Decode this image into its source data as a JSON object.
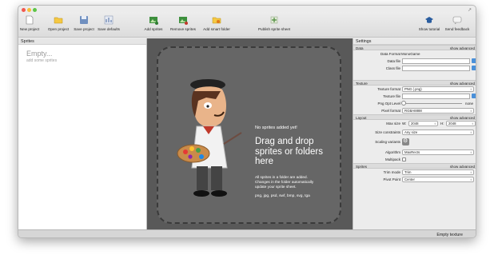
{
  "toolbar": {
    "new_project": "New project",
    "open_project": "Open project",
    "save_project": "Save project",
    "save_defaults": "Save defaults",
    "add_sprites": "Add sprites",
    "remove_sprites": "Remove sprites",
    "add_smart_folder": "Add smart folder",
    "publish": "Publish sprite sheet",
    "show_tutorial": "Show tutorial",
    "send_feedback": "Send feedback"
  },
  "sprites_panel": {
    "header": "Sprites",
    "empty_title": "Empty...",
    "empty_hint": "add some sprites"
  },
  "drop_area": {
    "no_sprites": "No sprites added yet!",
    "headline": "Drag and drop sprites or folders here",
    "info": "All sprites in a folder are added. Changes in the folder automatically update your sprite sheet.",
    "formats": "png, jpg, psd, swf, bmp, svg, tga"
  },
  "settings": {
    "header": "Settings",
    "show_advanced": "show advanced",
    "data": {
      "title": "Data",
      "data_format_label": "Data Format",
      "data_format_value": "MonoGame",
      "data_file_label": "Data file",
      "class_file_label": "Class file"
    },
    "texture": {
      "title": "Texture",
      "texture_format_label": "Texture format",
      "texture_format_value": "PNG (.png)",
      "texture_file_label": "Texture file",
      "png_opt_label": "Png Opt Level",
      "png_opt_value": "none",
      "pixel_format_label": "Pixel format",
      "pixel_format_value": "RGBA8888"
    },
    "layout": {
      "title": "Layout",
      "max_size_label": "Max size",
      "w_label": "W:",
      "w_value": "2048",
      "h_label": "H:",
      "h_value": "2048",
      "size_constraints_label": "Size constraints",
      "size_constraints_value": "Any size",
      "scaling_label": "Scaling variants",
      "algorithm_label": "Algorithm",
      "algorithm_value": "MaxRects",
      "multipack_label": "Multipack"
    },
    "sprites": {
      "title": "Sprites",
      "trim_mode_label": "Trim mode",
      "trim_mode_value": "Trim",
      "pivot_label": "Pivot Point",
      "pivot_value": "Center"
    }
  },
  "status": {
    "text": "Empty texture"
  },
  "colors": {
    "drop_bg": "#666666",
    "accent_blue": "#4a90d9"
  }
}
